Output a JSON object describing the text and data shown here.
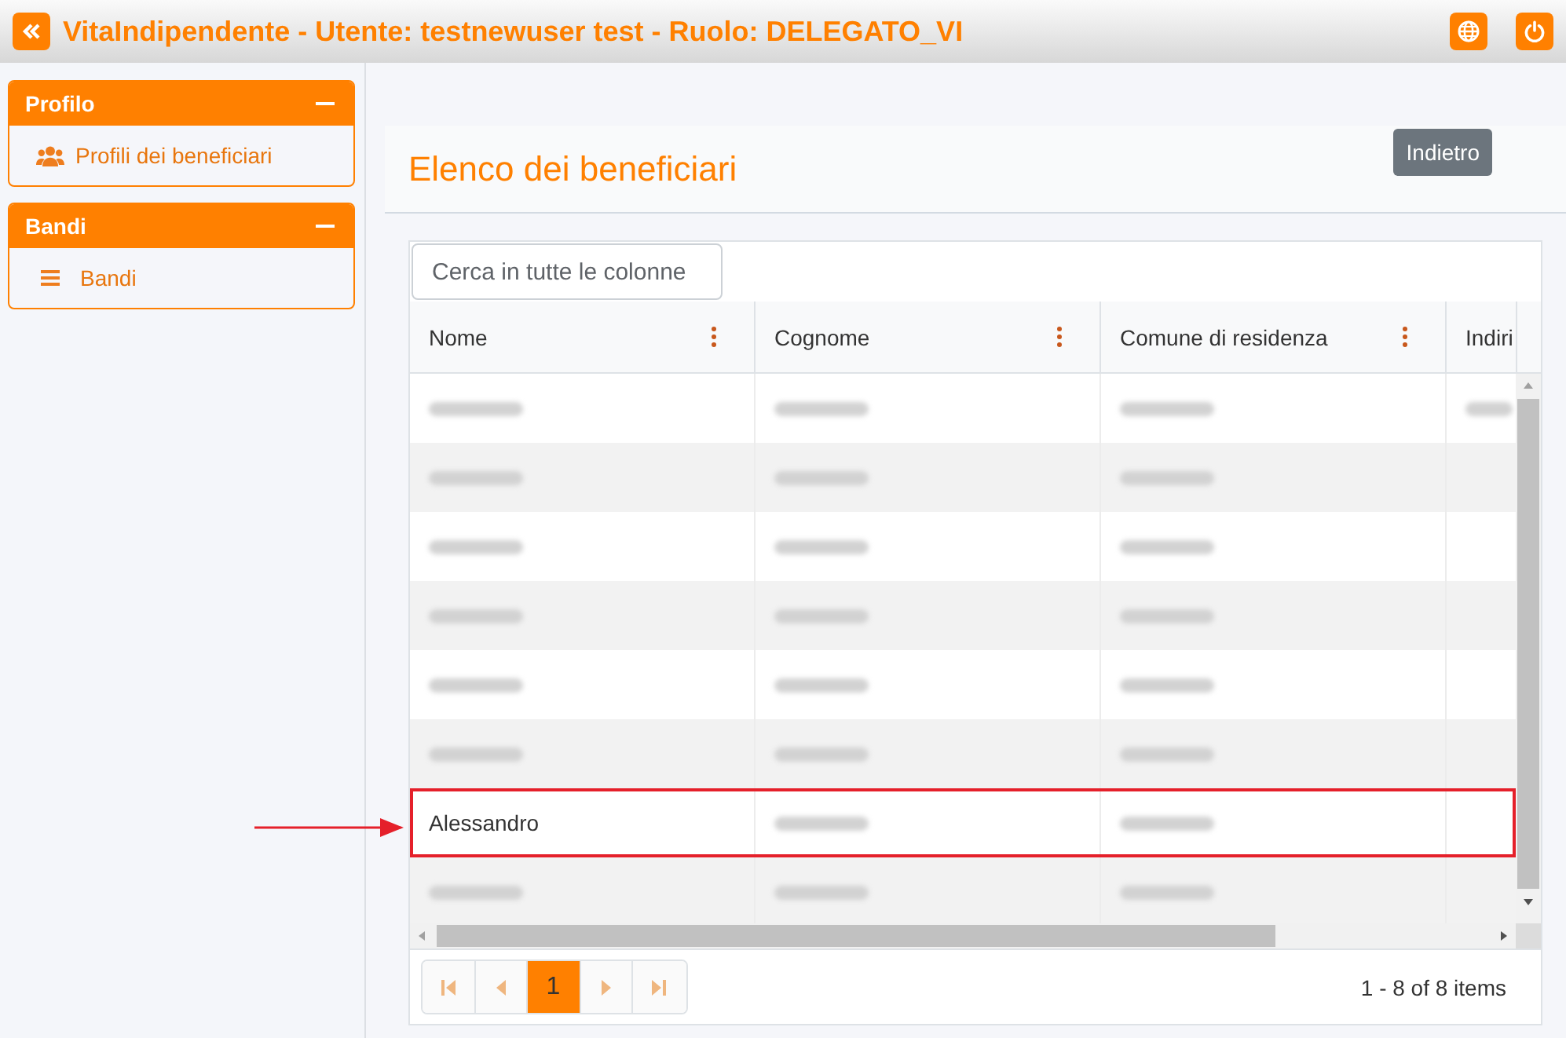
{
  "app_bar": {
    "title": "VitaIndipendente - Utente: testnewuser test - Ruolo: DELEGATO_VI"
  },
  "sidebar": {
    "panels": [
      {
        "title": "Profilo",
        "expanded": true,
        "items": [
          {
            "label": "Profili dei beneficiari"
          }
        ]
      },
      {
        "title": "Bandi",
        "expanded": true,
        "items": [
          {
            "label": "Bandi"
          }
        ]
      }
    ]
  },
  "page": {
    "title": "Elenco dei beneficiari",
    "back_button": "Indietro"
  },
  "grid": {
    "search": {
      "placeholder": "Cerca in tutte le colonne"
    },
    "columns": [
      {
        "title": "Nome",
        "menu": true
      },
      {
        "title": "Cognome",
        "menu": true
      },
      {
        "title": "Comune di residenza",
        "menu": true
      },
      {
        "title": "Indiri",
        "menu": false
      }
    ],
    "rows": [
      {
        "highlighted": false,
        "cells": [
          {
            "redacted": true
          },
          {
            "redacted": true
          },
          {
            "redacted": true
          },
          {
            "redacted": true
          }
        ]
      },
      {
        "highlighted": false,
        "cells": [
          {
            "redacted": true
          },
          {
            "redacted": true
          },
          {
            "redacted": true
          }
        ]
      },
      {
        "highlighted": false,
        "cells": [
          {
            "redacted": true
          },
          {
            "redacted": true
          },
          {
            "redacted": true
          }
        ]
      },
      {
        "highlighted": false,
        "cells": [
          {
            "redacted": true
          },
          {
            "redacted": true
          },
          {
            "redacted": true
          }
        ]
      },
      {
        "highlighted": false,
        "cells": [
          {
            "redacted": true
          },
          {
            "redacted": true
          },
          {
            "redacted": true
          }
        ]
      },
      {
        "highlighted": false,
        "cells": [
          {
            "redacted": true
          },
          {
            "redacted": true
          },
          {
            "redacted": true
          }
        ]
      },
      {
        "highlighted": true,
        "cells": [
          {
            "redacted": false,
            "text": "Alessandro"
          },
          {
            "redacted": true
          },
          {
            "redacted": true
          }
        ]
      },
      {
        "highlighted": false,
        "cells": [
          {
            "redacted": true
          },
          {
            "redacted": true
          },
          {
            "redacted": true
          }
        ]
      }
    ],
    "pager": {
      "buttons": [
        {
          "kind": "first",
          "disabled": true
        },
        {
          "kind": "previous",
          "disabled": true
        },
        {
          "kind": "page",
          "label": "1",
          "selected": true
        },
        {
          "kind": "next",
          "disabled": true
        },
        {
          "kind": "last",
          "disabled": true
        }
      ],
      "info": "1 - 8 of 8 items"
    }
  },
  "annotations": [
    {
      "kind": "arrow"
    }
  ]
}
